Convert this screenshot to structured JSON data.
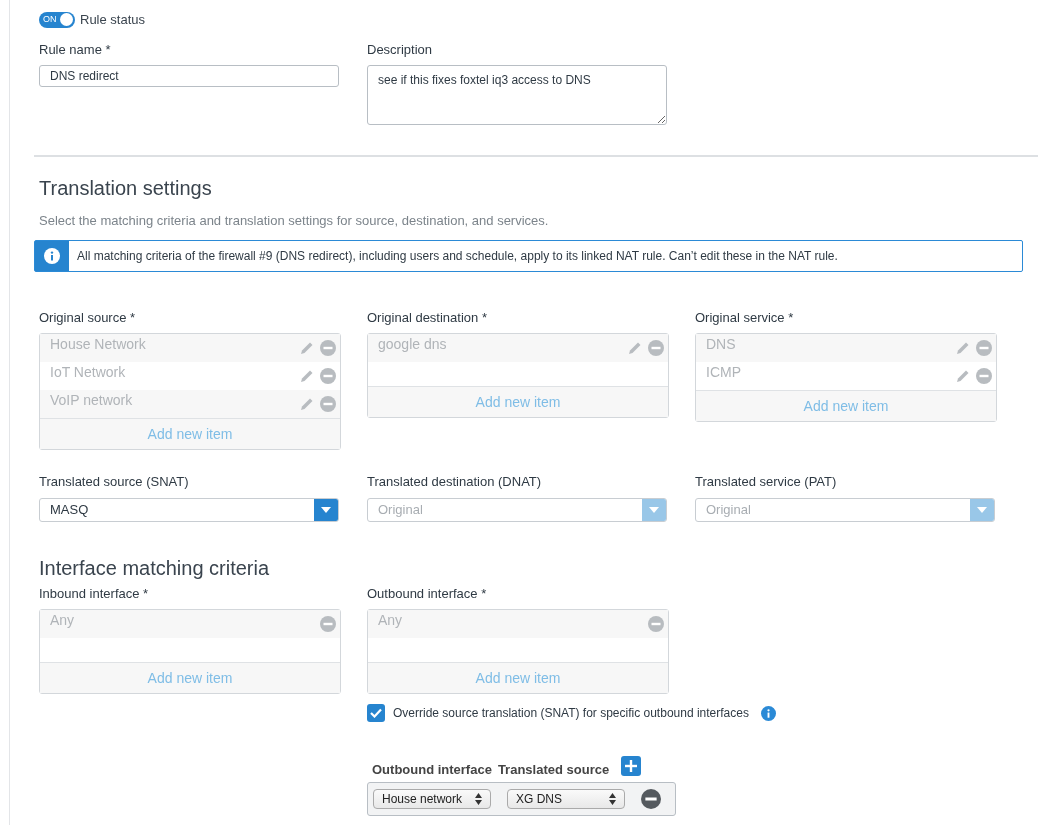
{
  "rule_status": {
    "toggle_text": "ON",
    "on": true,
    "label": "Rule status"
  },
  "rule_name": {
    "label": "Rule name *",
    "value": "DNS redirect"
  },
  "description": {
    "label": "Description",
    "value": "see if this fixes foxtel iq3 access to DNS"
  },
  "translation_settings": {
    "heading": "Translation settings",
    "subtitle": "Select the matching criteria and translation settings for source, destination, and services.",
    "info_banner": "All matching criteria of the firewall #9 (DNS redirect), including users and schedule, apply to its linked NAT rule. Can’t edit these in the NAT rule."
  },
  "original_lists": [
    {
      "label": "Original source *",
      "add_label": "Add new item",
      "items": [
        {
          "text": "House Network",
          "editable": true
        },
        {
          "text": "IoT Network",
          "editable": true
        },
        {
          "text": "VoIP network",
          "editable": true
        }
      ]
    },
    {
      "label": "Original destination *",
      "add_label": "Add new item",
      "items": [
        {
          "text": "google dns",
          "editable": true
        }
      ]
    },
    {
      "label": "Original service *",
      "add_label": "Add new item",
      "items": [
        {
          "text": "DNS",
          "editable": true
        },
        {
          "text": "ICMP",
          "editable": true
        }
      ]
    }
  ],
  "translated_selects": [
    {
      "label": "Translated source (SNAT)",
      "value": "MASQ",
      "disabled": false
    },
    {
      "label": "Translated destination (DNAT)",
      "value": "Original",
      "disabled": true
    },
    {
      "label": "Translated service (PAT)",
      "value": "Original",
      "disabled": true
    }
  ],
  "interface_matching": {
    "heading": "Interface matching criteria",
    "lists": [
      {
        "label": "Inbound interface *",
        "add_label": "Add new item",
        "items": [
          {
            "text": "Any",
            "editable": false
          }
        ]
      },
      {
        "label": "Outbound interface *",
        "add_label": "Add new item",
        "items": [
          {
            "text": "Any",
            "editable": false
          }
        ]
      }
    ]
  },
  "override_snat": {
    "label": "Override source translation (SNAT) for specific outbound interfaces",
    "checked": true
  },
  "outbound_table": {
    "columns": [
      "Outbound interface",
      "Translated source"
    ],
    "rows": [
      {
        "interface": "House network",
        "source": "XG DNS"
      }
    ]
  }
}
